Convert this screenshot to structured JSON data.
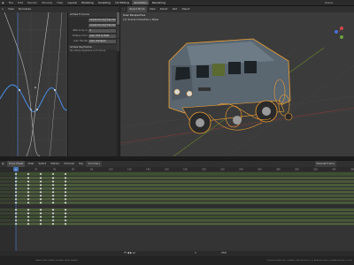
{
  "menu": {
    "items": [
      "File",
      "Edit",
      "Render",
      "Window",
      "Help"
    ],
    "workspaces": [
      "Layout",
      "Modeling",
      "Sculpting",
      "UV Editing",
      "Texture Paint",
      "Shading",
      "Animation",
      "Rendering",
      "Compositing",
      "Scripting"
    ],
    "active_workspace": "Animation",
    "scene": "Scene",
    "view_layer": "ViewLayer"
  },
  "graph_editor": {
    "view_label": "View",
    "normalize_label": "Normalize",
    "panel_fcurve_title": "Active F-Curve",
    "panel_fcurve_rows": [
      {
        "label": "",
        "value": "carpaint.body[\"blender.paint\"].Color"
      },
      {
        "label": "",
        "value": "carpaint.body[\"blender.paint\"].Color.a"
      },
      {
        "label": "RNA Array In",
        "value": "0"
      },
      {
        "label": "Display Color",
        "value": "Auto XYZ to RGB"
      },
      {
        "label": "Auto Handle",
        "value": "Auto Clamped"
      }
    ],
    "panel_keyframe_title": "Active Keyframe",
    "panel_keyframe_text": "No active keyframe on F-Curve",
    "tabs": [
      "F-Curve",
      "Modifiers",
      "View"
    ]
  },
  "viewport": {
    "mode": "Object Mode",
    "menus": [
      "View",
      "Select",
      "Add",
      "Object"
    ],
    "overlay_title": "User Perspective",
    "overlay_sub": "(1) Scene Collection | Base",
    "shading": "Solid"
  },
  "dopesheet": {
    "mode": "Dope Sheet",
    "menus": [
      "View",
      "Select",
      "Marker",
      "Channel",
      "Key"
    ],
    "filter": "Summary",
    "interpolation": "Nearest Frame",
    "ruler_ticks": [
      "0",
      "20",
      "40",
      "60",
      "80",
      "100",
      "120",
      "140",
      "160",
      "180",
      "200",
      "220",
      "240",
      "260",
      "280",
      "300",
      "320",
      "340",
      "360"
    ],
    "current_frame": "1"
  },
  "playback": {
    "start": "1",
    "end": "250",
    "frame": "1"
  },
  "statusbar": {
    "left": "Select   Box Select   Rotate View   Object",
    "right": "Scene Collection | Base | Verts:29,671 | Faces:28,932 | Objects:0/12 | 2.93"
  },
  "colors": {
    "accent": "#4772b3",
    "keyframe": "#e6e6e6",
    "curve_blue": "#4a8ee8",
    "selected_outline": "#f0a030"
  }
}
